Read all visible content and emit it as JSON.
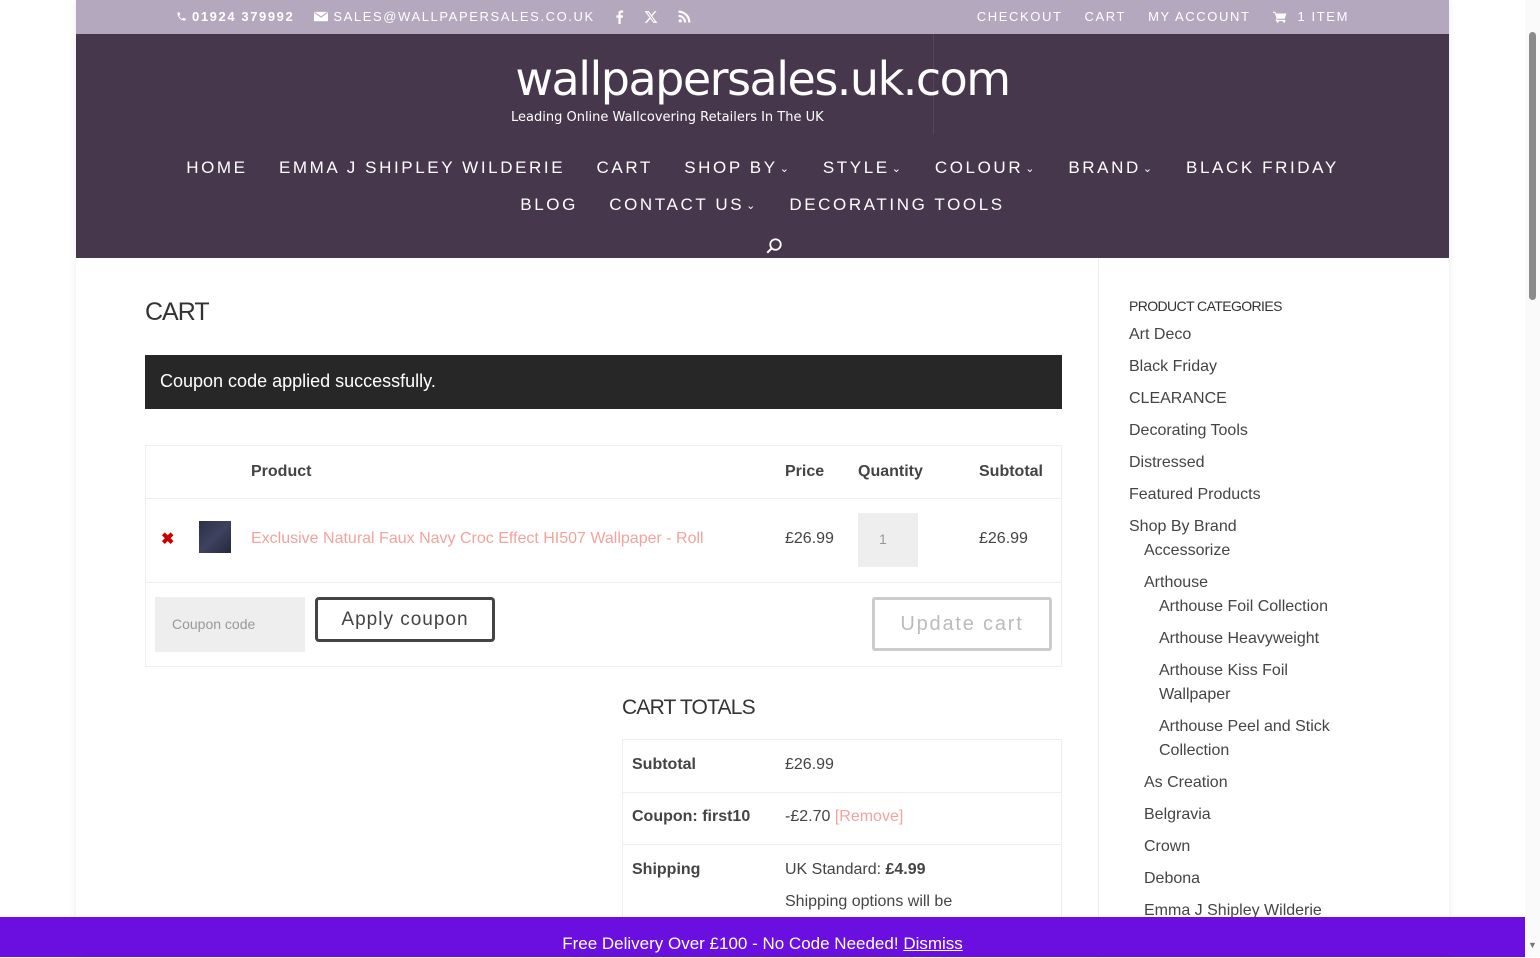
{
  "topbar": {
    "phone": "01924 379992",
    "email": "SALES@WALLPAPERSALES.CO.UK",
    "links": [
      "CHECKOUT",
      "CART",
      "MY ACCOUNT"
    ],
    "cart_items": "1 ITEM"
  },
  "header": {
    "logo": "wallpapersales.uk.com",
    "tagline": "Leading Online Wallcovering Retailers In The UK",
    "nav_row1": [
      {
        "label": "HOME",
        "dropdown": false
      },
      {
        "label": "EMMA J SHIPLEY WILDERIE",
        "dropdown": false
      },
      {
        "label": "CART",
        "dropdown": false
      },
      {
        "label": "SHOP BY",
        "dropdown": true
      },
      {
        "label": "STYLE",
        "dropdown": true
      },
      {
        "label": "COLOUR",
        "dropdown": true
      },
      {
        "label": "BRAND",
        "dropdown": true
      },
      {
        "label": "BLACK FRIDAY",
        "dropdown": false
      }
    ],
    "nav_row2": [
      {
        "label": "BLOG",
        "dropdown": false
      },
      {
        "label": "CONTACT US",
        "dropdown": true
      },
      {
        "label": "DECORATING TOOLS",
        "dropdown": false
      }
    ]
  },
  "main": {
    "title": "CART",
    "notice": "Coupon code applied successfully.",
    "cart_table": {
      "headers": {
        "product": "Product",
        "price": "Price",
        "quantity": "Quantity",
        "subtotal": "Subtotal"
      },
      "item": {
        "name": "Exclusive Natural Faux Navy Croc Effect HI507 Wallpaper - Roll",
        "price": "£26.99",
        "quantity": "1",
        "subtotal": "£26.99"
      },
      "coupon_placeholder": "Coupon code",
      "apply_label": "Apply coupon",
      "update_label": "Update cart"
    },
    "totals": {
      "title": "CART TOTALS",
      "subtotal_label": "Subtotal",
      "subtotal_value": "£26.99",
      "coupon_label": "Coupon: first10",
      "coupon_value": "-£2.70",
      "coupon_remove": "[Remove]",
      "shipping_label": "Shipping",
      "shipping_method": "UK Standard: ",
      "shipping_price": "£4.99",
      "shipping_note": "Shipping options will be"
    }
  },
  "sidebar": {
    "title": "PRODUCT CATEGORIES",
    "categories": [
      "Art Deco",
      "Black Friday",
      "CLEARANCE",
      "Decorating Tools",
      "Distressed",
      "Featured Products",
      "Shop By Brand",
      "Accessorize",
      "Arthouse",
      "Arthouse Foil Collection",
      "Arthouse Heavyweight",
      "Arthouse Kiss Foil",
      "Wallpaper",
      "Arthouse Peel and Stick",
      "Collection",
      "As Creation",
      "Belgravia",
      "Crown",
      "Debona",
      "Emma J Shipley Wilderie"
    ]
  },
  "notice_bar": {
    "text": "Free Delivery Over £100 - No Code Needed!",
    "dismiss": "Dismiss"
  },
  "colors": {
    "topbar": "#b3a8bd",
    "header": "#47374c",
    "link": "#f4a39c",
    "notice_bar": "#6a0fdf"
  }
}
